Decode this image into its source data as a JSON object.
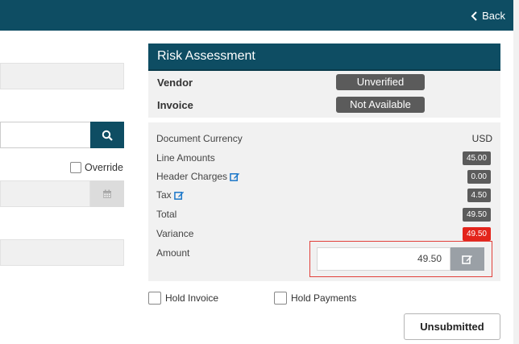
{
  "header": {
    "back_label": "Back"
  },
  "form": {
    "override_label": "Override"
  },
  "risk": {
    "title": "Risk Assessment",
    "rows": [
      {
        "label": "Vendor",
        "status": "Unverified"
      },
      {
        "label": "Invoice",
        "status": "Not Available"
      }
    ]
  },
  "totals": {
    "document_currency_label": "Document Currency",
    "document_currency": "USD",
    "line_amounts_label": "Line Amounts",
    "line_amounts": "45.00",
    "header_charges_label": "Header Charges",
    "header_charges": "0.00",
    "tax_label": "Tax",
    "tax": "4.50",
    "total_label": "Total",
    "total": "49.50",
    "variance_label": "Variance",
    "variance": "49.50",
    "amount_label": "Amount",
    "amount": "49.50"
  },
  "actions": {
    "hold_invoice_label": "Hold Invoice",
    "hold_payments_label": "Hold Payments",
    "unsubmitted_label": "Unsubmitted"
  },
  "colors": {
    "brand": "#0e4d63",
    "alert": "#e3241b",
    "badge": "#5b5b5b"
  }
}
